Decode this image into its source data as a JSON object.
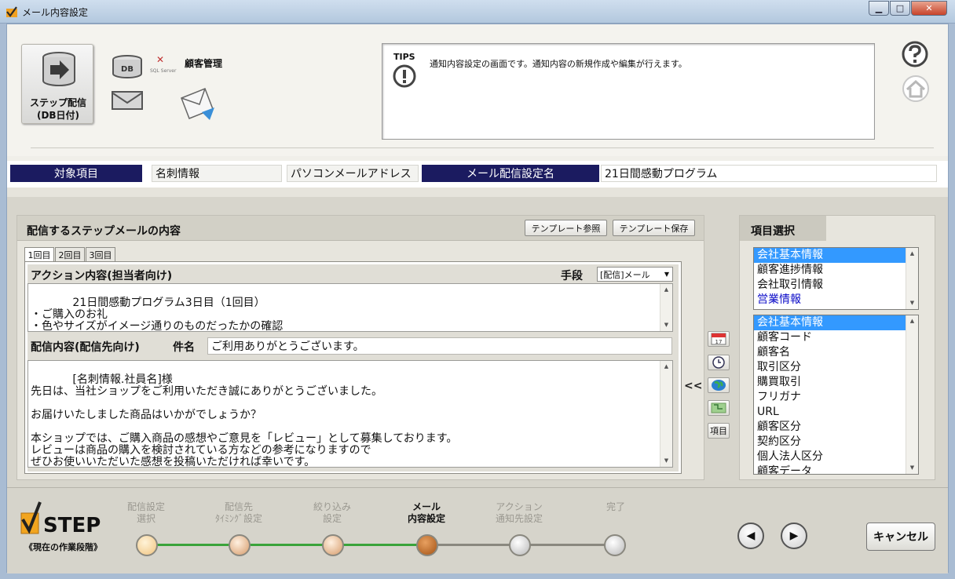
{
  "window": {
    "title": "メール内容設定",
    "minimize": "▁",
    "maximize": "□",
    "close": "✕"
  },
  "header": {
    "step_button_label_1": "ステップ配信",
    "step_button_label_2": "(DB日付)",
    "db_label": "DB",
    "sql_logo": "SQL Server",
    "customer_mgmt": "顧客管理",
    "tips_label": "TIPS",
    "tips_text": "通知内容設定の画面です。通知内容の新規作成や編集が行えます。"
  },
  "info": {
    "target_label": "対象項目",
    "target_value": "名刺情報",
    "address_value": "パソコンメールアドレス",
    "setting_label": "メール配信設定名",
    "setting_value": "21日間感動プログラム"
  },
  "content": {
    "panel_title": "配信するステップメールの内容",
    "template_ref": "テンプレート参照",
    "template_save": "テンプレート保存",
    "tabs": [
      {
        "label": "1回目"
      },
      {
        "label": "2回目"
      },
      {
        "label": "3回目"
      }
    ],
    "action_label": "アクション内容(担当者向け)",
    "method_label": "手段",
    "method_value": "[配信]メール",
    "action_text": "21日間感動プログラム3日目（1回目）\n・ご購入のお礼\n・色やサイズがイメージ通りのものだったかの確認",
    "delivery_label": "配信内容(配信先向け)",
    "subject_label": "件名",
    "subject_value": "ご利用ありがとうございます。",
    "body_text": "[名刺情報.社員名]様\n先日は、当社ショップをご利用いただき誠にありがとうございました。\n\nお届けいたしました商品はいかがでしょうか？\n\n本ショップでは、ご購入商品の感想やご意見を「レビュー」として募集しております。\nレビューは商品の購入を検討されている方などの参考になりますので\nぜひお使いいただいた感想を投稿いただければ幸いです。"
  },
  "side_tools": {
    "insert": "<<",
    "calendar_label": "17",
    "item_button": "項目"
  },
  "item_select": {
    "title": "項目選択",
    "categories": [
      "会社基本情報",
      "顧客進捗情報",
      "会社取引情報",
      "営業情報"
    ],
    "fields": [
      "会社基本情報",
      "顧客コード",
      "顧客名",
      "取引区分",
      "購買取引",
      "フリガナ",
      "URL",
      "顧客区分",
      "契約区分",
      "個人法人区分",
      "顧客データ"
    ]
  },
  "footer": {
    "step_logo": "STEP",
    "step_caption": "《現在の作業段階》",
    "steps": [
      {
        "l1": "配信設定",
        "l2": "選択"
      },
      {
        "l1": "配信先",
        "l2": "ﾀｲﾐﾝｸﾞ設定"
      },
      {
        "l1": "絞り込み",
        "l2": "設定"
      },
      {
        "l1": "メール",
        "l2": "内容設定"
      },
      {
        "l1": "アクション",
        "l2": "通知先設定"
      },
      {
        "l1": "完了",
        "l2": ""
      }
    ],
    "prev": "◀",
    "next": "▶",
    "cancel": "キャンセル"
  }
}
